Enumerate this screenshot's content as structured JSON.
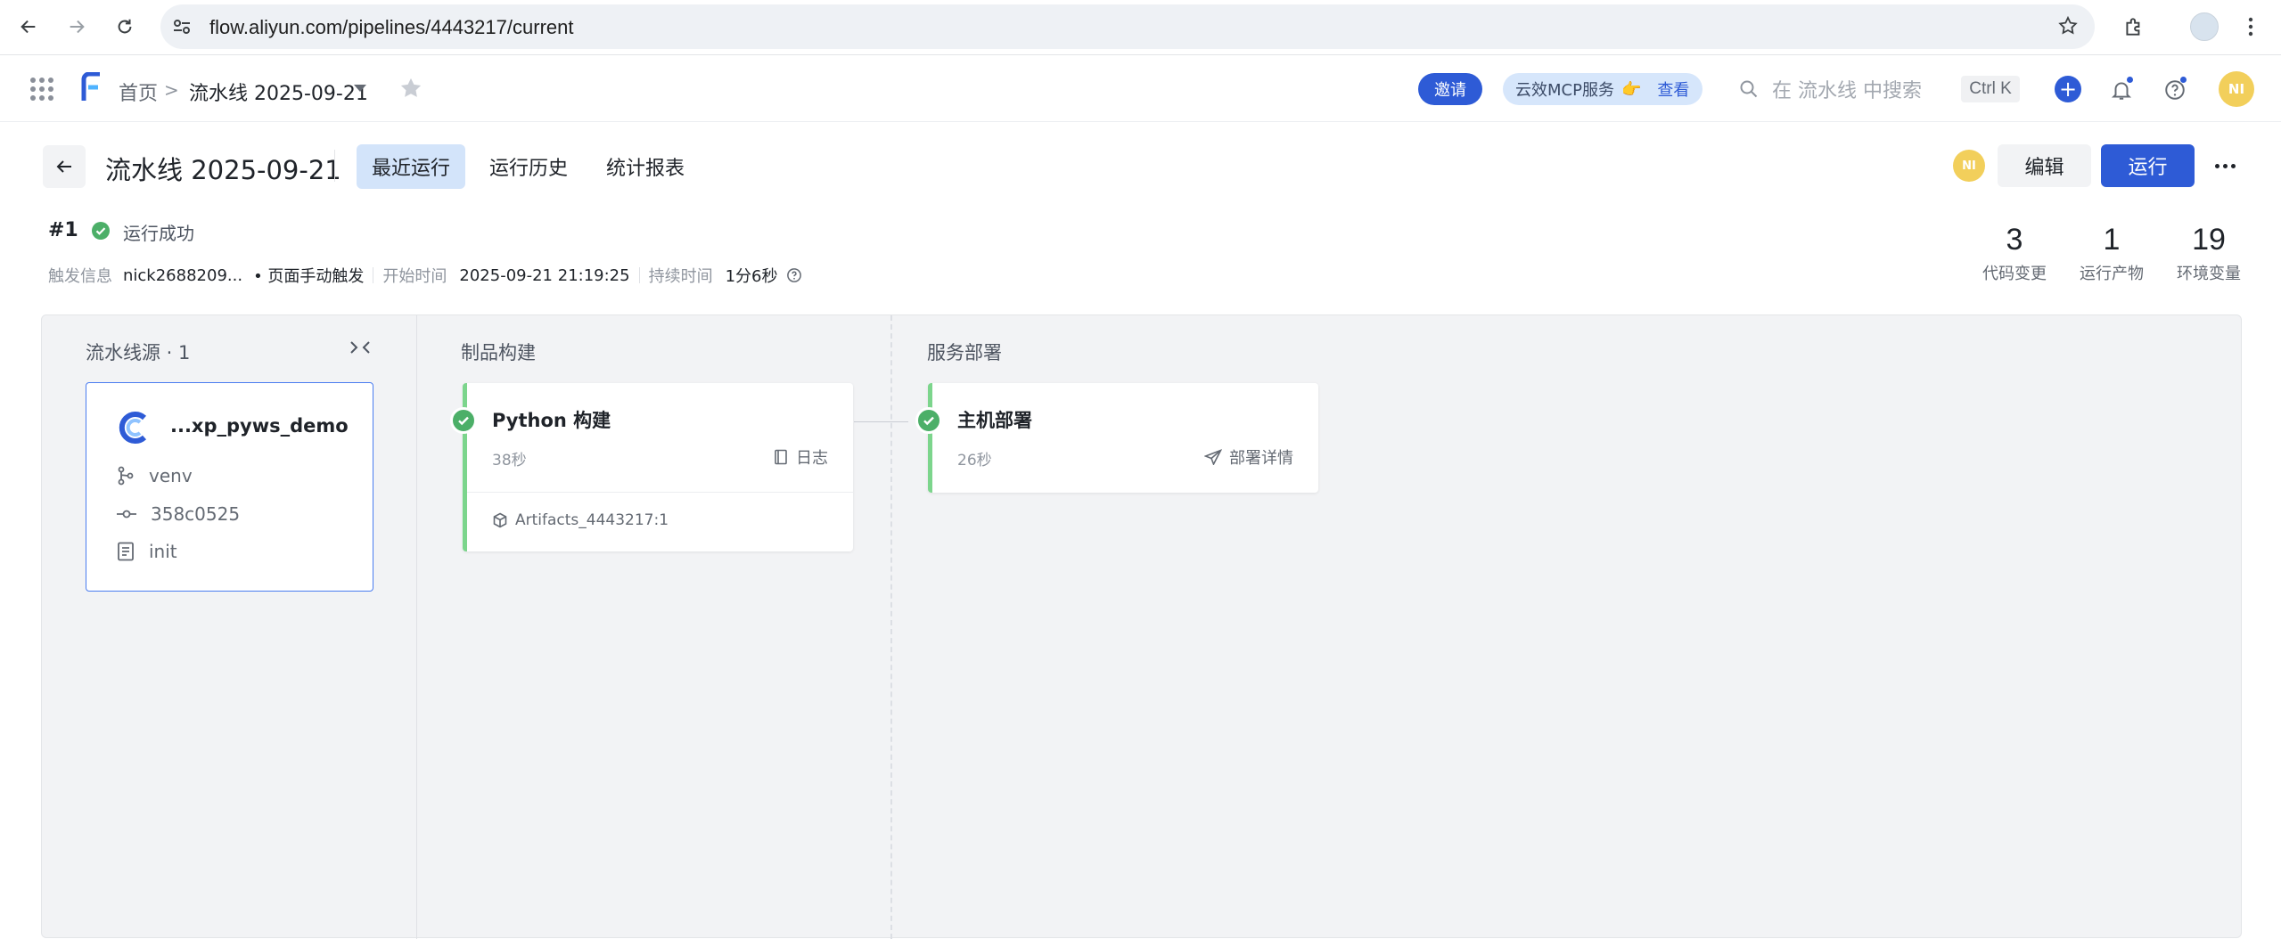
{
  "browser": {
    "url": "flow.aliyun.com/pipelines/4443217/current"
  },
  "header": {
    "breadcrumb_home": "首页",
    "breadcrumb_sep": ">",
    "breadcrumb_current": "流水线 2025-09-21",
    "invite_label": "邀请",
    "mcp_label": "云效MCP服务",
    "mcp_emoji": "👉",
    "mcp_link": "查看",
    "search_placeholder": "在 流水线 中搜索",
    "shortcut": "Ctrl K",
    "plus_label": "+",
    "avatar_initials": "NI"
  },
  "pipeline": {
    "title": "流水线 2025-09-21",
    "tabs": [
      "最近运行",
      "运行历史",
      "统计报表"
    ],
    "active_tab": "最近运行",
    "avatar_initials": "NI",
    "edit_label": "编辑",
    "run_label": "运行"
  },
  "run": {
    "number": "#1",
    "status": "运行成功",
    "trigger_label": "触发信息",
    "trigger_user": "nick2688209...",
    "trigger_mode": "• 页面手动触发",
    "start_label": "开始时间",
    "start_time": "2025-09-21 21:19:25",
    "duration_label": "持续时间",
    "duration": "1分6秒"
  },
  "stats": [
    {
      "value": "3",
      "label": "代码变更"
    },
    {
      "value": "1",
      "label": "运行产物"
    },
    {
      "value": "19",
      "label": "环境变量"
    }
  ],
  "canvas": {
    "source_header": "流水线源 · 1",
    "build_header": "制品构建",
    "deploy_header": "服务部署",
    "source": {
      "name": "...xp_pyws_demo",
      "branch": "venv",
      "commit": "358c0525",
      "message": "init"
    },
    "build_job": {
      "title": "Python 构建",
      "duration": "38秒",
      "link": "日志",
      "artifact": "Artifacts_4443217:1"
    },
    "deploy_job": {
      "title": "主机部署",
      "duration": "26秒",
      "link": "部署详情"
    }
  },
  "colors": {
    "primary": "#2e5bd6",
    "success": "#4caf68",
    "tab_active_bg": "#d3e4fa",
    "avatar": "#f2cf5b"
  }
}
